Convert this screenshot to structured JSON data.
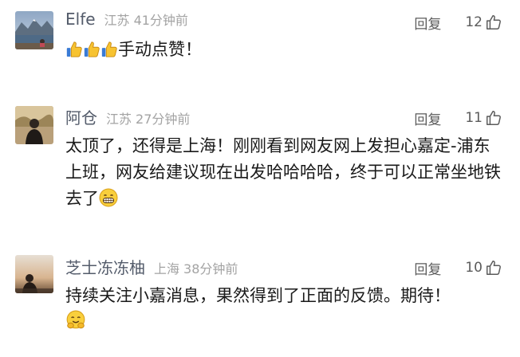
{
  "comments": [
    {
      "user": "Elfe",
      "location": "江苏",
      "time": "41分钟前",
      "reply_label": "回复",
      "likes": "12",
      "text": "手动点赞！"
    },
    {
      "user": "阿仓",
      "location": "江苏",
      "time": "27分钟前",
      "reply_label": "回复",
      "likes": "11",
      "text": "太顶了，还得是上海！刚刚看到网友网上发担心嘉定-浦东上班，网友给建议现在出发哈哈哈哈，终于可以正常坐地铁去了"
    },
    {
      "user": "芝士冻冻柚",
      "location": "上海",
      "time": "38分钟前",
      "reply_label": "回复",
      "likes": "10",
      "text": "持续关注小嘉消息，果然得到了正面的反馈。期待！"
    }
  ],
  "icons": {
    "like": "thumbs-up-outline-icon",
    "emoji_thumbs": "thumbs-up-emoji-icon",
    "emoji_grin": "grinning-face-emoji-icon",
    "emoji_hug": "hugging-face-emoji-icon"
  }
}
